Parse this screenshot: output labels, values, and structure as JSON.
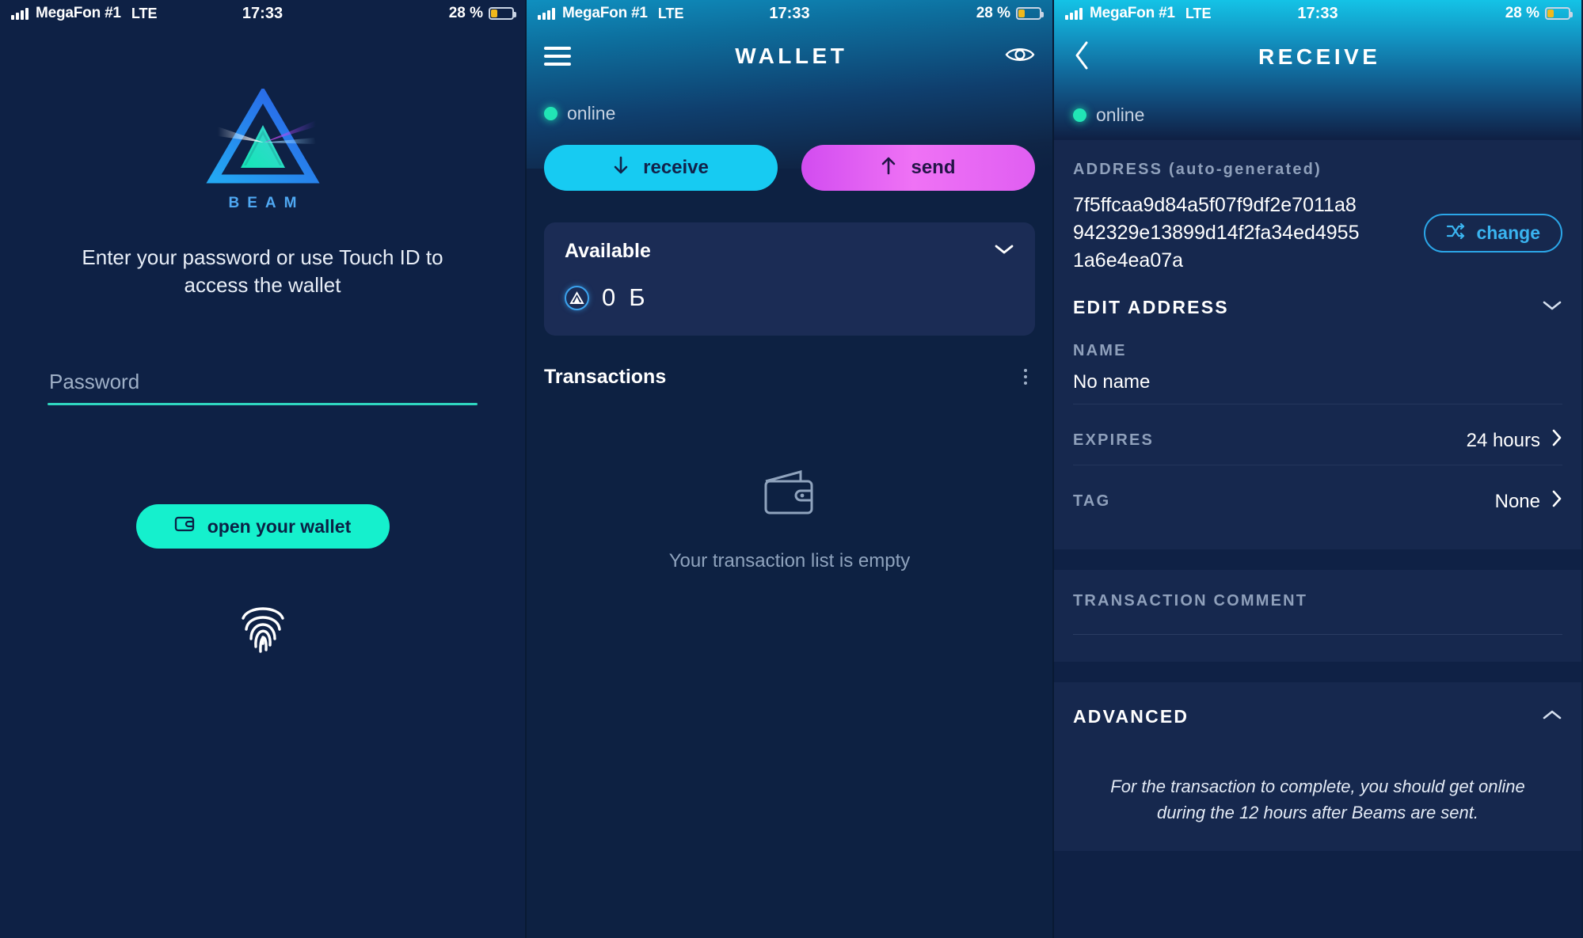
{
  "status_bar": {
    "carrier": "MegaFon #1",
    "network": "LTE",
    "time": "17:33",
    "battery_percent": "28 %"
  },
  "colors": {
    "page_bg": "#0e2145",
    "accent_teal": "#15f0cd",
    "accent_cyan": "#17cbf2",
    "accent_magenta": "#e05ef2",
    "accent_blue": "#3ab4f0",
    "online_green": "#21e5b5",
    "card_bg": "#1b2c55",
    "label_grey": "#8fa0bb"
  },
  "login_screen": {
    "logo_icon": "beam-triangle-logo",
    "brand": "BEAM",
    "hint": "Enter your password or use Touch ID to access the wallet",
    "password_input": {
      "value": "",
      "placeholder": "Password"
    },
    "open_button": {
      "label": "open your wallet",
      "icon": "wallet-icon"
    },
    "touch_id_icon": "fingerprint-icon"
  },
  "wallet_screen": {
    "menu_icon": "hamburger-menu-icon",
    "title": "WALLET",
    "eye_icon": "eye-icon",
    "status": "online",
    "actions": [
      {
        "label": "receive",
        "icon": "arrow-down-icon"
      },
      {
        "label": "send",
        "icon": "arrow-up-icon"
      }
    ],
    "available": {
      "label": "Available",
      "amount": "0",
      "currency_symbol": "Б",
      "coin_icon": "beam-coin-icon",
      "collapse_icon": "chevron-down-icon"
    },
    "transactions": {
      "title": "Transactions",
      "menu_icon": "kebab-menu-icon",
      "empty_icon": "wallet-outline-icon",
      "empty_text": "Your transaction list is empty"
    }
  },
  "receive_screen": {
    "back_icon": "chevron-left-icon",
    "title": "RECEIVE",
    "status": "online",
    "address": {
      "label": "ADDRESS (auto-generated)",
      "value": "7f5ffcaa9d84a5f07f9df2e7011a8942329e13899d14f2fa34ed49551a6e4ea07a",
      "change_button": {
        "label": "change",
        "icon": "shuffle-icon"
      }
    },
    "edit_address": {
      "title": "EDIT ADDRESS",
      "icon": "chevron-down-icon"
    },
    "name": {
      "label": "NAME",
      "value": "No name"
    },
    "expires": {
      "label": "EXPIRES",
      "value": "24 hours",
      "icon": "chevron-right-icon"
    },
    "tag": {
      "label": "TAG",
      "value": "None",
      "icon": "chevron-right-icon"
    },
    "transaction_comment": {
      "label": "TRANSACTION COMMENT",
      "value": ""
    },
    "advanced": {
      "title": "ADVANCED",
      "icon": "chevron-up-icon",
      "note": "For the transaction to complete, you should get online during the 12 hours after Beams are sent."
    }
  }
}
